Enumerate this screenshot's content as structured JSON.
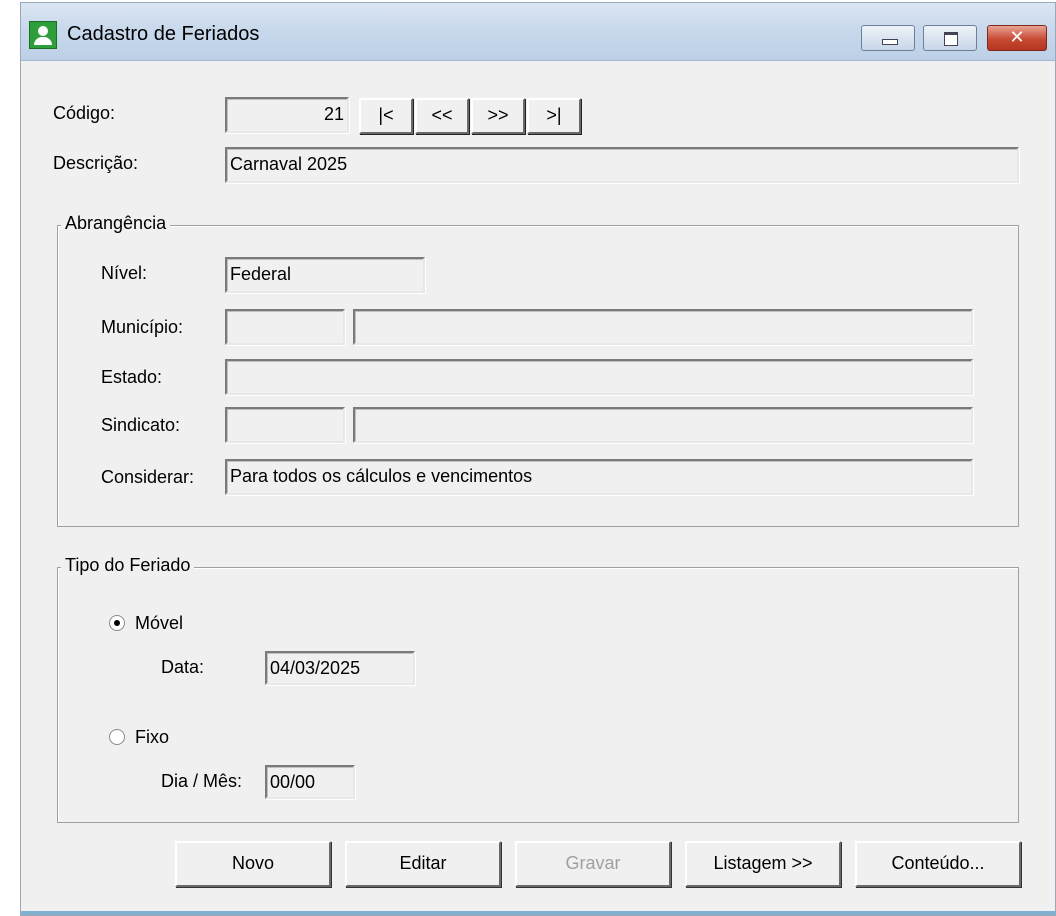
{
  "window": {
    "title": "Cadastro de Feriados",
    "title_buttons": {
      "close": "✕"
    }
  },
  "codigo": {
    "label": "Código:",
    "value": "21",
    "nav": {
      "first": "|<",
      "prev": "<<",
      "next": ">>",
      "last": ">|"
    }
  },
  "descricao": {
    "label": "Descrição:",
    "value": "Carnaval 2025"
  },
  "abrangencia": {
    "title": "Abrangência",
    "nivel": {
      "label": "Nível:",
      "value": "Federal"
    },
    "municipio": {
      "label": "Município:",
      "code": "",
      "name": ""
    },
    "estado": {
      "label": "Estado:",
      "value": ""
    },
    "sindicato": {
      "label": "Sindicato:",
      "code": "",
      "name": ""
    },
    "considerar": {
      "label": "Considerar:",
      "value": "Para todos os cálculos e vencimentos"
    }
  },
  "tipo": {
    "title": "Tipo do Feriado",
    "movel": {
      "label": "Móvel",
      "checked": true,
      "data_label": "Data:",
      "data_value": "04/03/2025"
    },
    "fixo": {
      "label": "Fixo",
      "checked": false,
      "dia_mes_label": "Dia / Mês:",
      "dia_mes_value": "00/00"
    }
  },
  "buttons": {
    "novo": "Novo",
    "editar": "Editar",
    "gravar": "Gravar",
    "listagem": "Listagem >>",
    "conteudo": "Conteúdo..."
  },
  "colors": {
    "accent_bottom": "#7fb0cf",
    "window_bg": "#f0f0f0",
    "close_red": "#c74a33"
  }
}
